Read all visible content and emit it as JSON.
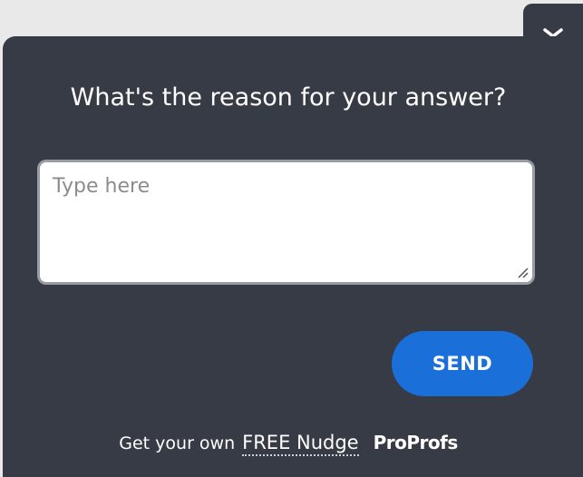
{
  "survey": {
    "question": "What's the reason for your answer?",
    "answer_value": "",
    "answer_placeholder": "Type here",
    "send_label": "SEND"
  },
  "footer": {
    "prefix": "Get your own",
    "link_label": "FREE Nudge",
    "brand": "ProProfs"
  },
  "icons": {
    "collapse": "chevron-down-icon",
    "resize": "resize-handle-icon"
  },
  "colors": {
    "panel_background": "#373b45",
    "page_background": "#e9e9ea",
    "send_button": "#1a6fd8",
    "text": "#ffffff",
    "textarea_border": "#9a9ca3"
  }
}
